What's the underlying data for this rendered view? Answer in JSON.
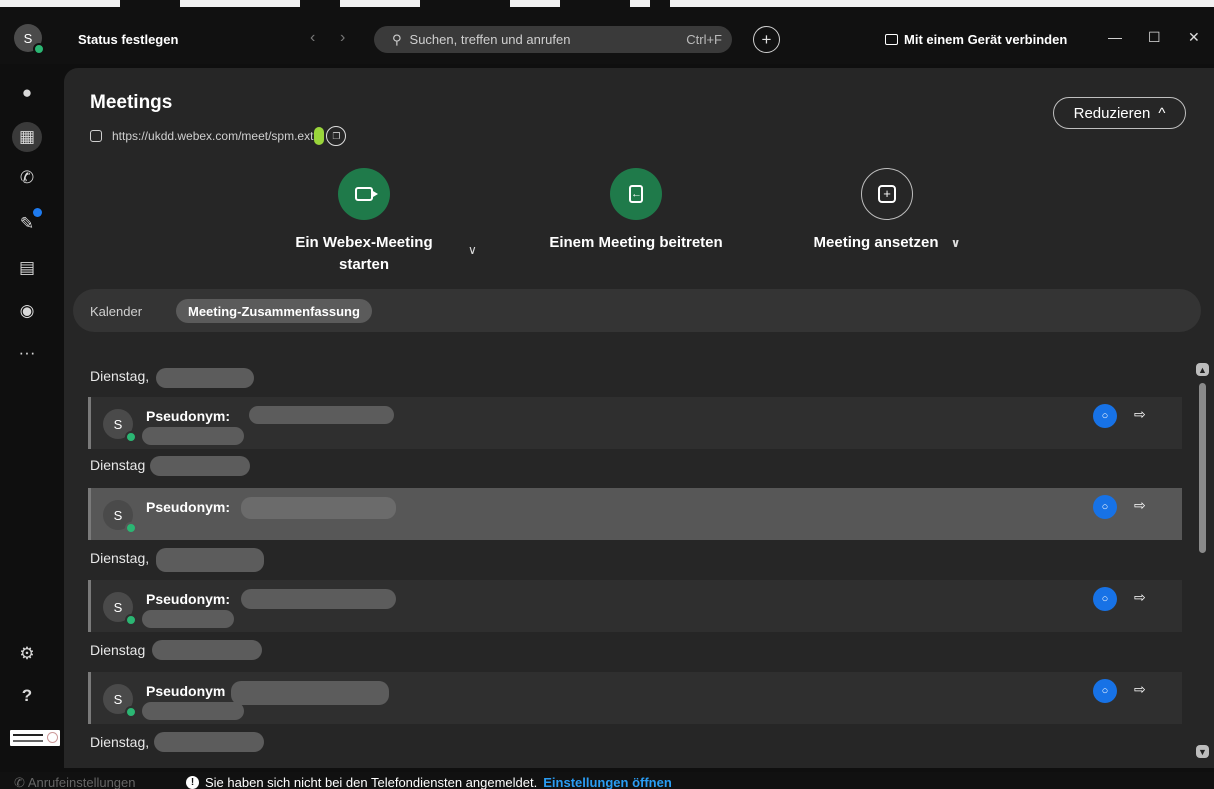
{
  "titlebar": {
    "avatar_initial": "S",
    "status_link": "Status festlegen",
    "back": "‹",
    "forward": "›",
    "search_placeholder": "Suchen, treffen und anrufen",
    "search_shortcut": "Ctrl+F",
    "plus": "+",
    "connect_label": "Mit einem Gerät verbinden",
    "minimize": "—",
    "maximize": "☐",
    "close": "✕"
  },
  "rail": {
    "icons": [
      "chat-icon",
      "calendar-icon",
      "phone-icon",
      "whiteboard-icon",
      "contacts-icon",
      "teams-icon",
      "more-icon"
    ],
    "more_label": "···",
    "settings": "⚙",
    "help": "?"
  },
  "main": {
    "title": "Meetings",
    "url": "https://ukdd.webex.com/meet/spm.ext",
    "collapse_label": "Reduzieren",
    "collapse_chev": "^",
    "actions": {
      "start": {
        "line1": "Ein Webex-Meeting",
        "line2": "starten",
        "chev": "∨"
      },
      "join": {
        "label": "Einem Meeting beitreten"
      },
      "schedule": {
        "label": "Meeting ansetzen",
        "chev": "∨"
      }
    },
    "tabs": {
      "calendar": "Kalender",
      "summary": "Meeting-Zusammenfassung"
    },
    "days": [
      "Dienstag,",
      "Dienstag",
      "Dienstag,",
      "Dienstag",
      "Dienstag,"
    ],
    "rows": [
      {
        "initial": "S",
        "name": "Pseudonym:"
      },
      {
        "initial": "S",
        "name": "Pseudonym:"
      },
      {
        "initial": "S",
        "name": "Pseudonym:"
      },
      {
        "initial": "S",
        "name": "Pseudonym"
      }
    ]
  },
  "footer": {
    "call_settings": "Anrufeinstellungen",
    "info_icon": "!",
    "message": "Sie haben sich nicht bei den Telefondiensten angemeldet.",
    "link": "Einstellungen öffnen"
  },
  "colors": {
    "accent_green": "#1f7a4a",
    "presence": "#2bb673",
    "chat_blue": "#1772e6",
    "link_blue": "#2a9df4"
  }
}
